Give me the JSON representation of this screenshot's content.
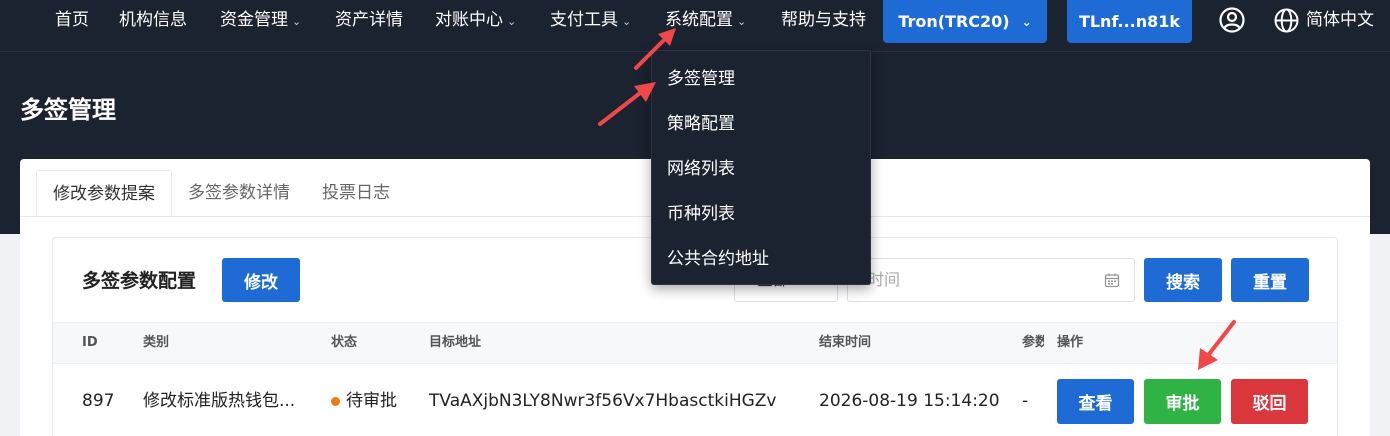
{
  "nav": {
    "items": [
      {
        "label": "首页",
        "has_menu": false
      },
      {
        "label": "机构信息",
        "has_menu": false
      },
      {
        "label": "资金管理",
        "has_menu": true
      },
      {
        "label": "资产详情",
        "has_menu": false
      },
      {
        "label": "对账中心",
        "has_menu": true
      },
      {
        "label": "支付工具",
        "has_menu": true
      },
      {
        "label": "系统配置",
        "has_menu": true
      },
      {
        "label": "帮助与支持",
        "has_menu": false
      }
    ],
    "network_label": "Tron(TRC20)",
    "address_label": "TLnf...n81k",
    "language_label": "简体中文"
  },
  "page": {
    "title": "多签管理"
  },
  "tabs": [
    {
      "label": "修改参数提案",
      "active": true
    },
    {
      "label": "多签参数详情",
      "active": false
    },
    {
      "label": "投票日志",
      "active": false
    }
  ],
  "section": {
    "title": "多签参数配置",
    "edit_button": "修改",
    "select_value": "全部",
    "time_placeholder": "时间",
    "search_button": "搜索",
    "reset_button": "重置"
  },
  "table": {
    "columns": [
      "ID",
      "类别",
      "状态",
      "目标地址",
      "结束时间",
      "参数",
      "操作"
    ],
    "rows": [
      {
        "id": "897",
        "category": "修改标准版热钱包...",
        "status": "待审批",
        "target_address": "TVaAXjbN3LY8Nwr3f56Vx7HbasctkiHGZv",
        "end_time": "2026-08-19 15:14:20",
        "params": "-",
        "actions": {
          "view": "查看",
          "approve": "审批",
          "reject": "驳回"
        }
      }
    ]
  },
  "dropdown": {
    "items": [
      "多签管理",
      "策略配置",
      "网络列表",
      "币种列表",
      "公共合约地址"
    ]
  },
  "colors": {
    "nav_bg": "#1b2230",
    "primary": "#1e6bd6",
    "success": "#2fb344",
    "danger": "#d9363e",
    "pending": "#f07b12",
    "annotation_arrow": "#f04848"
  }
}
